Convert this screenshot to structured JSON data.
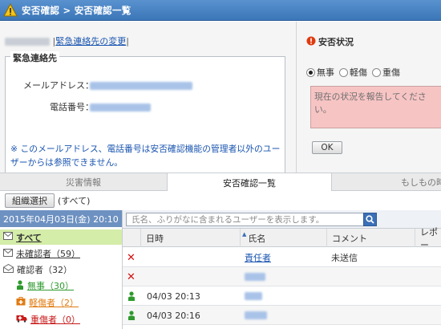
{
  "header": {
    "title": "安否確認 > 安否確認一覧"
  },
  "user": {
    "change_link": "緊急連絡先の変更"
  },
  "contact": {
    "legend": "緊急連絡先",
    "email_label": "メールアドレス：",
    "phone_label": "電話番号：",
    "note": "※ このメールアドレス、電話番号は安否確認機能の管理者以外のユーザーからは参照できません。"
  },
  "status": {
    "title": "安否状況",
    "options": [
      "無事",
      "軽傷",
      "重傷"
    ],
    "selected": "無事",
    "textarea_placeholder": "現在の状況を報告してください。",
    "ok_label": "OK"
  },
  "tabs": [
    "災害情報",
    "安否確認一覧",
    "もしもの時"
  ],
  "active_tab": "安否確認一覧",
  "toolbar": {
    "org_button": "組織選択",
    "scope": "(すべて)"
  },
  "left": {
    "date": "2015年04月03日(金) 20:10",
    "items": [
      {
        "label": "すべて"
      },
      {
        "label": "未確認者（59）"
      },
      {
        "label": "確認者（32）"
      },
      {
        "label": "無事（30）"
      },
      {
        "label": "軽傷者（2）"
      },
      {
        "label": "重傷者（0）"
      }
    ]
  },
  "search": {
    "placeholder": "氏名、ふりがなに含まれるユーザーを表示します。"
  },
  "table": {
    "headers": [
      "日時",
      "氏名",
      "コメント",
      "レポー"
    ],
    "rows": [
      {
        "status": "unconfirmed",
        "datetime": "",
        "name": "責任者",
        "comment": "未送信"
      },
      {
        "status": "unconfirmed",
        "datetime": "",
        "name": "",
        "comment": ""
      },
      {
        "status": "safe",
        "datetime": "04/03 20:13",
        "name": "",
        "comment": ""
      },
      {
        "status": "safe",
        "datetime": "04/03 20:16",
        "name": "",
        "comment": ""
      }
    ]
  },
  "colors": {
    "title_bar": "#3b76b8",
    "safe_green": "#2e9a2e",
    "minor_orange": "#e07a10",
    "serious_red": "#c81818",
    "link_blue": "#1a55b0",
    "textarea_pink": "#f7c4c4"
  }
}
